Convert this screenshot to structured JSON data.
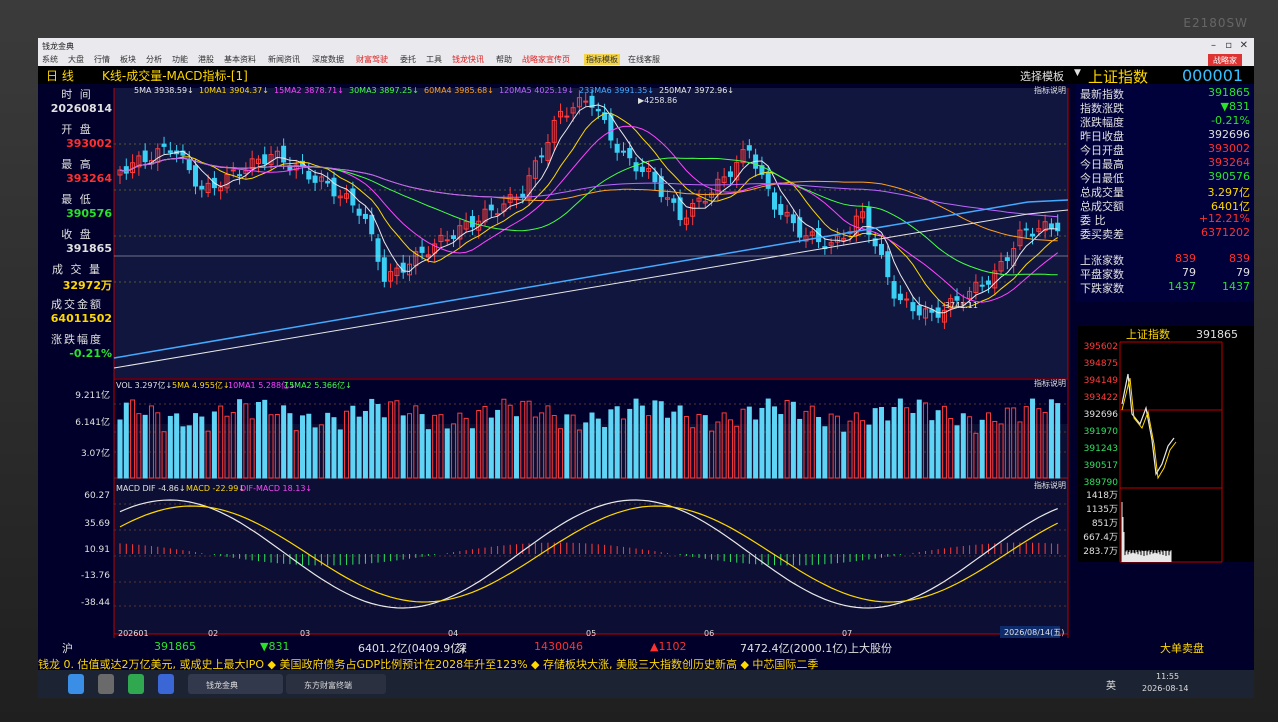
{
  "window": {
    "app_title": "钱龙金典",
    "brand": "E2180SW",
    "login_label": "战略家"
  },
  "menu": [
    "系统",
    "大盘",
    "行情",
    "板块",
    "分析",
    "功能",
    "港股",
    "基本资料",
    "新闻资讯",
    "深度数据",
    "财富驾驶",
    "委托",
    "工具",
    "钱龙快讯",
    "帮助",
    "战略家宣传页",
    "指标模板",
    "在线客服"
  ],
  "chart_header": {
    "period": "日  线",
    "title": "K线-成交量-MACD指标-[1]",
    "template": "选择模板",
    "index_name": "上证指数",
    "index_code": "000001",
    "indicator_help": "指标说明"
  },
  "ma_legend": [
    {
      "label": "5MA 3938.59",
      "color": "#e8e8e8"
    },
    {
      "label": "10MA1 3904.37",
      "color": "#ffd800"
    },
    {
      "label": "15MA2 3878.71",
      "color": "#ff44ff"
    },
    {
      "label": "30MA3 3897.25",
      "color": "#44ff44"
    },
    {
      "label": "60MA4 3985.68",
      "color": "#ffa020"
    },
    {
      "label": "120MA5 4025.19",
      "color": "#bb66ff"
    },
    {
      "label": "233MA6 3991.35",
      "color": "#44aaff"
    },
    {
      "label": "250MA7 3972.96",
      "color": "#e8e8e8"
    }
  ],
  "left_panel": [
    {
      "label": "时  间",
      "value": "20260814",
      "color": "wht"
    },
    {
      "label": "开  盘",
      "value": "393002",
      "color": "up"
    },
    {
      "label": "最  高",
      "value": "393264",
      "color": "up"
    },
    {
      "label": "最  低",
      "value": "390576",
      "color": "down"
    },
    {
      "label": "收  盘",
      "value": "391865",
      "color": "wht"
    },
    {
      "label": "成 交 量",
      "value": "32972万",
      "color": "yel"
    },
    {
      "label": "成交金额",
      "value": "64011502",
      "color": "yel"
    },
    {
      "label": "涨跌幅度",
      "value": "-0.21%",
      "color": "down"
    }
  ],
  "right_panel": [
    {
      "key": "最新指数",
      "value": "391865",
      "color": "down"
    },
    {
      "key": "指数涨跌",
      "value": "▼831",
      "color": "down"
    },
    {
      "key": "涨跌幅度",
      "value": "-0.21%",
      "color": "down"
    },
    {
      "key": "昨日收盘",
      "value": "392696",
      "color": "wht"
    },
    {
      "key": "今日开盘",
      "value": "393002",
      "color": "up"
    },
    {
      "key": "今日最高",
      "value": "393264",
      "color": "up"
    },
    {
      "key": "今日最低",
      "value": "390576",
      "color": "down"
    },
    {
      "key": "总成交量",
      "value": "3.297亿",
      "color": "yel"
    },
    {
      "key": "总成交额",
      "value": "6401亿",
      "color": "yel"
    },
    {
      "key": "委    比",
      "value": "+12.21%",
      "color": "up"
    },
    {
      "key": "委买卖差",
      "value": "6371202",
      "color": "up"
    }
  ],
  "breadth": [
    {
      "key": "上涨家数",
      "v1": "839",
      "v2": "839",
      "color": "up"
    },
    {
      "key": "平盘家数",
      "v1": "79",
      "v2": "79",
      "color": "wht"
    },
    {
      "key": "下跌家数",
      "v1": "1437",
      "v2": "1437",
      "color": "down"
    }
  ],
  "kline": {
    "high_label": "4258.86",
    "low_label": "3741.11",
    "y_top": "3995?",
    "ylabels": []
  },
  "volume": {
    "legend": [
      "VOL 3.297亿",
      "5MA 4.955亿",
      "10MA1 5.288亿",
      "15MA2 5.366亿"
    ],
    "ylabels": [
      "9.211亿",
      "6.141亿",
      "3.07亿"
    ]
  },
  "macd": {
    "legend": [
      "MACD DIF -4.86",
      "MACD -22.99",
      "DIF-MACD 18.13"
    ],
    "ylabels": [
      "60.27",
      "35.69",
      "10.91",
      "-13.76",
      "-38.44"
    ]
  },
  "xaxis": [
    "202601",
    "02",
    "03",
    "04",
    "05",
    "06",
    "07",
    "08"
  ],
  "cursor_date": "2026/08/14(五)",
  "mini_panel": {
    "title": "上证指数",
    "value": "391865",
    "price_labels": [
      "395602",
      "394875",
      "394149",
      "393422",
      "392696",
      "391970",
      "391243",
      "390517",
      "389790"
    ],
    "vol_labels": [
      "1418万",
      "1135万",
      "851万",
      "667.4万",
      "283.7万"
    ]
  },
  "status": {
    "sh_label": "沪",
    "sh_value": "391865",
    "sh_change": "▼831",
    "sh_amount": "6401.2亿(0409.9亿)",
    "sz_label": "深",
    "sz_value": "1430046",
    "sz_change": "▲1102",
    "sz_amount": "7472.4亿(2000.1亿)",
    "stock": "上大股份",
    "right": "大单卖盘"
  },
  "ticker": "钱龙 0. 估值或达2万亿美元, 或成史上最大IPO ◆ 美国政府债务占GDP比例预计在2028年升至123% ◆ 存储板块大涨, 美股三大指数创历史新高 ◆ 中芯国际二季",
  "taskbar": {
    "app1": "钱龙金典",
    "app2": "东方财富终端",
    "time": "11:55",
    "date": "2026-08-14",
    "ime": "英"
  }
}
